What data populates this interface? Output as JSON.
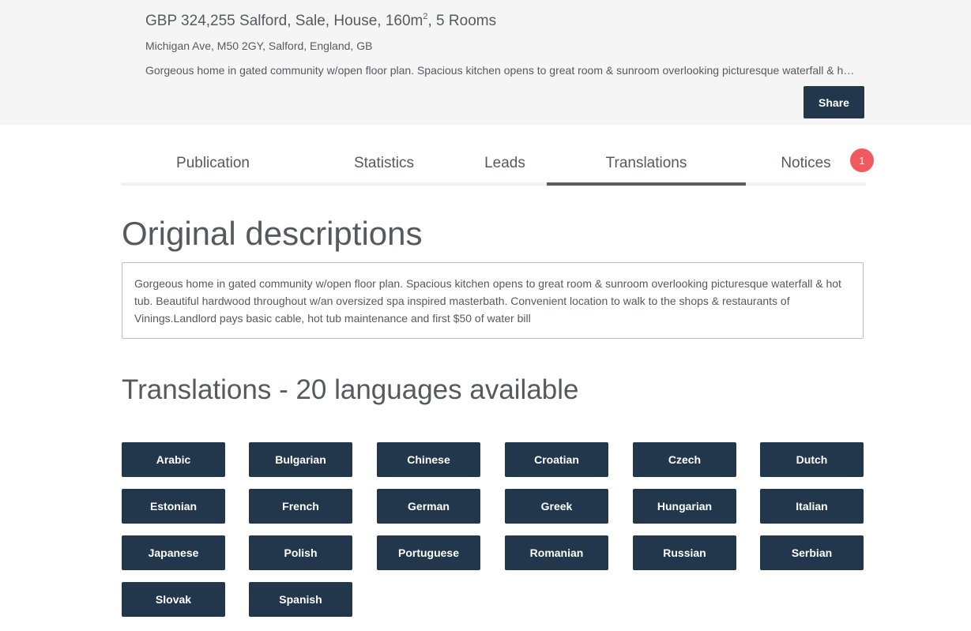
{
  "listing": {
    "title_main": "GBP 324,255 Salford, Sale, House, 160m",
    "title_sup": "2",
    "title_rest": ", 5 Rooms",
    "address": "Michigan Ave, M50 2GY, Salford, England, GB",
    "summary": "Gorgeous home in gated community w/open floor plan. Spacious kitchen opens to great room & sunroom overlooking picturesque waterfall & hot tub. Beautiful hardwood throughout w/an oversized spa inspired masterbath.",
    "share_label": "Share"
  },
  "tabs": [
    {
      "label": "Publication",
      "active": false
    },
    {
      "label": "Statistics",
      "active": false
    },
    {
      "label": "Leads",
      "active": false
    },
    {
      "label": "Translations",
      "active": true
    },
    {
      "label": "Notices",
      "active": false
    }
  ],
  "notices_badge": "1",
  "original": {
    "heading": "Original descriptions",
    "text": "Gorgeous home in gated community w/open floor plan. Spacious kitchen opens to great room & sunroom overlooking picturesque waterfall & hot tub. Beautiful hardwood throughout w/an oversized spa inspired masterbath. Convenient location to walk to the shops & restaurants of Vinings.Landlord pays basic cable, hot tub maintenance and first $50 of water bill"
  },
  "translations": {
    "heading": "Translations - 20 languages available",
    "languages": [
      "Arabic",
      "Bulgarian",
      "Chinese",
      "Croatian",
      "Czech",
      "Dutch",
      "Estonian",
      "French",
      "German",
      "Greek",
      "Hungarian",
      "Italian",
      "Japanese",
      "Polish",
      "Portuguese",
      "Romanian",
      "Russian",
      "Serbian",
      "Slovak",
      "Spanish"
    ]
  },
  "colors": {
    "button_bg": "#22374b",
    "badge_bg": "#f05a5f",
    "header_bg": "#f5f5f5"
  }
}
